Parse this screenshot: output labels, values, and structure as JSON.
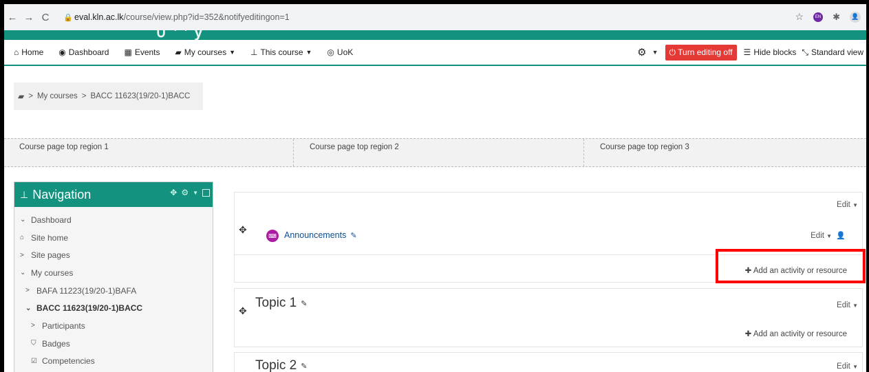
{
  "browser": {
    "url_host": "eval.kln.ac.lk",
    "url_path": "/course/view.php?id=352&notifyeditingon=1",
    "profile_initials": "EN"
  },
  "brand": {
    "partial_text": "∪ ’ ’ y"
  },
  "navbar": {
    "home": "Home",
    "dashboard": "Dashboard",
    "events": "Events",
    "my_courses": "My courses",
    "this_course": "This course",
    "uok": "UoK",
    "turn_editing_off": "Turn editing off",
    "hide_blocks": "Hide blocks",
    "standard_view": "Standard view"
  },
  "breadcrumb": {
    "items": [
      "My courses",
      "BACC 11623(19/20-1)BACC"
    ],
    "separator": ">"
  },
  "top_regions": [
    "Course page top region 1",
    "Course page top region 2",
    "Course page top region 3"
  ],
  "navigation_block": {
    "title": "Navigation",
    "items": [
      {
        "label": "Dashboard",
        "prefix": "⌄"
      },
      {
        "label": "Site home",
        "prefix": "⌂"
      },
      {
        "label": "Site pages",
        "prefix": ">"
      },
      {
        "label": "My courses",
        "prefix": "⌄"
      },
      {
        "label": "BAFA 11223(19/20-1)BAFA",
        "prefix": ">"
      },
      {
        "label": "BACC 11623(19/20-1)BACC",
        "prefix": "⌄"
      },
      {
        "label": "Participants",
        "prefix": ">"
      },
      {
        "label": "Badges",
        "prefix": "⛉"
      },
      {
        "label": "Competencies",
        "prefix": "☑"
      }
    ]
  },
  "course": {
    "edit_label": "Edit",
    "add_activity": "Add an activity or resource",
    "announcements": "Announcements",
    "topics": [
      "Topic 1",
      "Topic 2"
    ]
  },
  "colors": {
    "brand_teal": "#12927f",
    "editing_red": "#e53935",
    "highlight_red": "#ff0000",
    "link_blue": "#0f4d8f",
    "forum_purple": "#ac1ca3"
  }
}
